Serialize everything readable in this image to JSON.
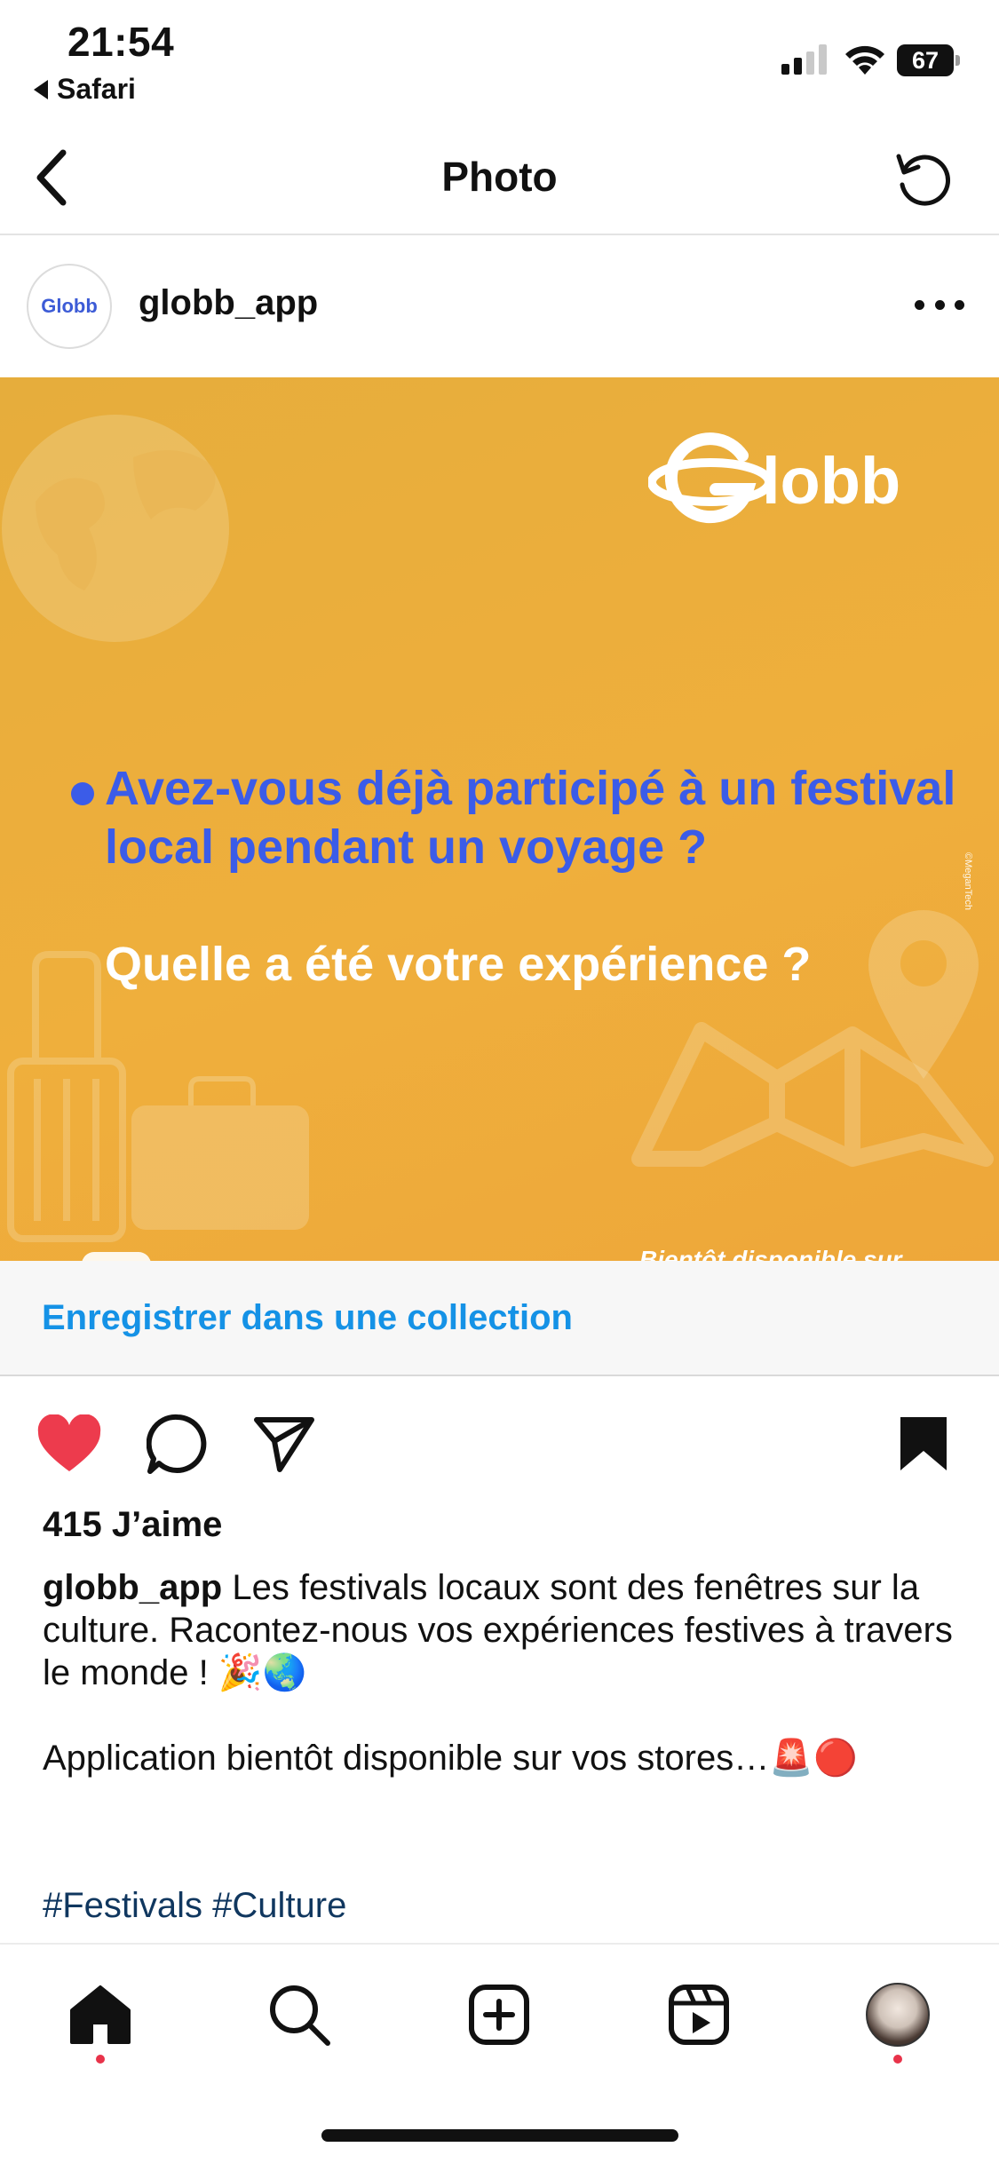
{
  "status_bar": {
    "time": "21:54",
    "back_app": "Safari",
    "battery": "67"
  },
  "nav": {
    "title": "Photo",
    "back_icon": "chevron-left-icon",
    "refresh_icon": "refresh-icon"
  },
  "post": {
    "username": "globb_app",
    "avatar_text": "Globb",
    "image": {
      "logo_text": "Globb",
      "question_1": "Avez-vous déjà participé à un festival local pendant un voyage ?",
      "question_2": "Quelle a été votre expérience ?",
      "footer_text": "Bientôt disponible sur",
      "side_mark": "©MeganTech"
    },
    "save_collection": "Enregistrer dans une collection",
    "likes": "415 J’aime",
    "caption_user": "globb_app",
    "caption_text": " Les festivals locaux sont des fenêtres sur la culture. Racontez-nous vos expériences festives à travers le monde ! 🎉🌏",
    "caption_line2": "Application bientôt disponible sur vos stores…🚨🔴",
    "hashtags": "#Festivals #Culture"
  },
  "colors": {
    "like_red": "#ed3b4d",
    "link_blue": "#1592e6",
    "banner_orange": "#eead3c",
    "question_blue": "#3b5ce8",
    "hashtag_navy": "#10375f"
  },
  "tabs": [
    {
      "icon": "home-icon",
      "active": true
    },
    {
      "icon": "search-icon"
    },
    {
      "icon": "new-post-icon"
    },
    {
      "icon": "reels-icon"
    },
    {
      "icon": "profile-avatar"
    }
  ]
}
